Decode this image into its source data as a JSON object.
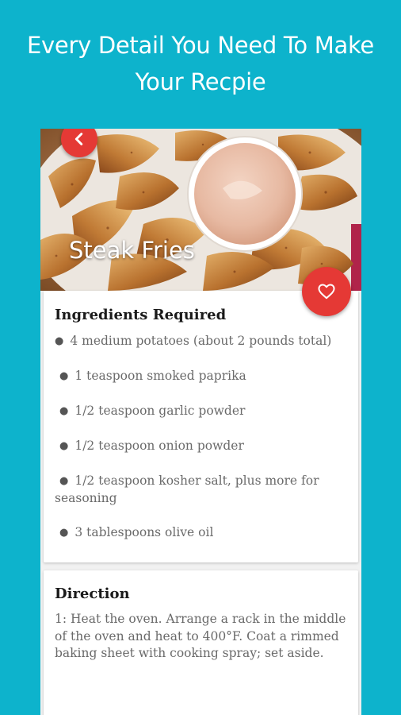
{
  "headline": {
    "line1": "Every Detail You Need To Make",
    "line2": "Your Recpie"
  },
  "recipe": {
    "title": "Steak Fries",
    "hero_image": "potato wedges with dipping sauce"
  },
  "ingredients": {
    "heading": "Ingredients Required",
    "items": [
      "4 medium potatoes (about 2 pounds total)",
      "1 teaspoon smoked paprika",
      "1/2 teaspoon garlic powder",
      "1/2 teaspoon onion powder",
      "1/2 teaspoon kosher salt, plus more for seasoning",
      "3 tablespoons olive oil"
    ]
  },
  "direction": {
    "heading": "Direction",
    "text": "1: Heat the oven. Arrange a rack in the middle of the oven and heat to 400°F. Coat a rimmed baking sheet with cooking spray; set aside."
  },
  "icons": {
    "back": "chevron-left-icon",
    "favorite": "heart-outline-icon"
  },
  "colors": {
    "background": "#0db3cc",
    "accent": "#e53935",
    "card": "#ffffff"
  }
}
